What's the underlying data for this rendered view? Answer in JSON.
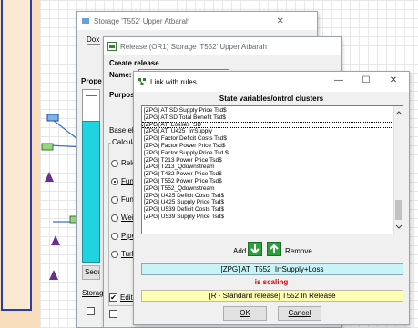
{
  "storage_window": {
    "title": "Storage 'T552' Upper Atbarah",
    "close": "✕",
    "menu_partial": "Dox",
    "prope_partial": "Prope",
    "seq_partial": "Sequ",
    "storage_partial": "Storag"
  },
  "release_window": {
    "title": "Release (OR1) Storage 'T552' Upper Atbarah",
    "create_release": "Create release",
    "name_label": "Name:",
    "purpose_label": "Purpose:",
    "base_elev_label": "Base eleva",
    "calc_label": "Calculatio",
    "options": [
      "Release",
      "Function",
      "Function",
      "Weir hy",
      "Pipeline",
      "Turbine"
    ],
    "selected_option": 1,
    "edit_label": "Edit",
    "edit_checked": "✔"
  },
  "link_window": {
    "title": "Link with rules",
    "minimize": "—",
    "maximize": "☐",
    "close": "✕",
    "header": "State variables/ontrol clusters",
    "items": [
      "[ZPG] AT SD Supply Price Tsd$",
      "[ZPG] AT SD Total Benefit Tsd$",
      "[ZPG] AT_Losses_SD",
      "[ZPG] AT_U425_IrrSupply",
      "[ZPG] Factor Deficit Costs Tsd$",
      "[ZPG] Factor Power Price Tsd$",
      "[ZPG] Factor Supply Price Tsd $",
      "[ZPG] T213 Power Price Tsd$",
      "[ZPG] T213_Qdownstream",
      "[ZPG] T432 Power Price Tsd$",
      "[ZPG] T552 Power Price Tsd$",
      "[ZPG] T552_Qdownstream",
      "[ZPG] U425 Deficit Costs Tsd$",
      "[ZPG] U425 Supply Price Tsd$",
      "[ZPG] U539 Deficit Costs Tsd$",
      "[ZPG] U539 Supply Price Tsd$"
    ],
    "add_label": "Add",
    "remove_label": "Remove",
    "selected_variable": "[ZPG] AT_T552_IrrSupply+Loss",
    "status_text": "is scaling",
    "release_text": "[R - Standard release] T552 In Release",
    "ok_label": "OK",
    "cancel_label": "Cancel",
    "colors": {
      "cyan": "#c8f4f7",
      "yellow": "#ffffb4",
      "status_red": "#d40000",
      "green": "#2aa13a"
    }
  }
}
